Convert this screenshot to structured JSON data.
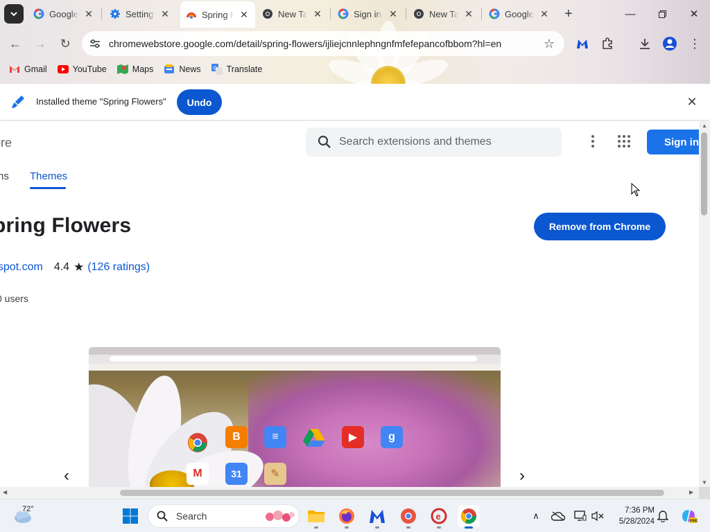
{
  "browser": {
    "tabs": [
      {
        "title": "Google",
        "favicon": "google-icon",
        "active": false
      },
      {
        "title": "Settings",
        "favicon": "settings-gear-icon",
        "active": false
      },
      {
        "title": "Spring Flowers",
        "favicon": "chrome-web-store-icon",
        "active": true
      },
      {
        "title": "New Tab",
        "favicon": "chrome-icon",
        "active": false
      },
      {
        "title": "Sign in",
        "favicon": "google-icon",
        "active": false
      },
      {
        "title": "New Tab",
        "favicon": "chrome-icon",
        "active": false
      },
      {
        "title": "Google",
        "favicon": "google-icon",
        "active": false
      }
    ],
    "url": "chromewebstore.google.com/detail/spring-flowers/ijliejcnnlephngnfmfefepancofbbom?hl=en",
    "bookmarks": [
      {
        "label": "Gmail",
        "icon": "gmail-icon"
      },
      {
        "label": "YouTube",
        "icon": "youtube-icon"
      },
      {
        "label": "Maps",
        "icon": "maps-icon"
      },
      {
        "label": "News",
        "icon": "news-icon"
      },
      {
        "label": "Translate",
        "icon": "translate-icon"
      }
    ]
  },
  "infobar": {
    "message": "Installed theme \"Spring Flowers\"",
    "undo_label": "Undo"
  },
  "store": {
    "name_partial": "tore",
    "search_placeholder": "Search extensions and themes",
    "signin_label": "Sign in",
    "nav_extensions_partial": "ns",
    "nav_themes": "Themes",
    "title_partial": "pring Flowers",
    "remove_label": "Remove from Chrome",
    "site_partial": "gspot.com",
    "rating": "4.4",
    "ratings_count": "(126 ratings)",
    "users_partial": "0 users"
  },
  "taskbar": {
    "temperature": "72°",
    "search_label": "Search",
    "time": "7:36 PM",
    "date": "5/28/2024"
  },
  "colors": {
    "accent": "#0b57d0",
    "signin": "#1a73e8"
  }
}
